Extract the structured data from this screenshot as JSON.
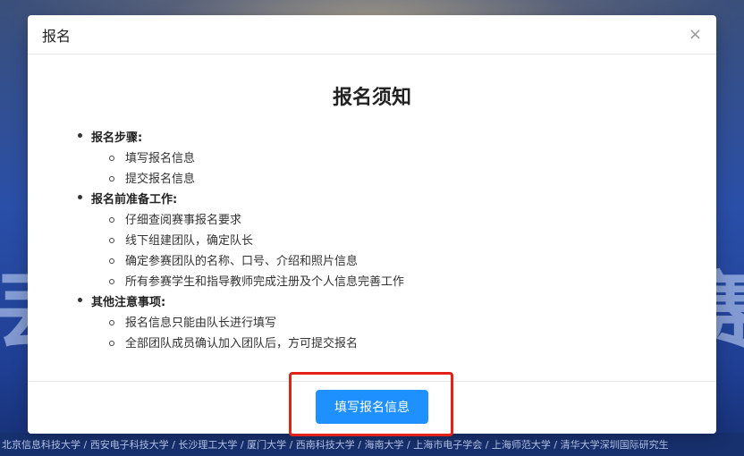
{
  "background": {
    "big_left_text": "丟",
    "big_right_text": "赛",
    "universities": "北京信息科技大学 / 西安电子科技大学 / 长沙理工大学 / 厦门大学 / 西南科技大学 / 海南大学 / 上海市电子学会 / 上海师范大学 / 清华大学深圳国际研究生"
  },
  "modal": {
    "title": "报名",
    "close_icon": "×",
    "notice_title": "报名须知",
    "sections": [
      {
        "label": "报名步骤:",
        "items": [
          "填写报名信息",
          "提交报名信息"
        ]
      },
      {
        "label": "报名前准备工作:",
        "items": [
          "仔细查阅赛事报名要求",
          "线下组建团队，确定队长",
          "确定参赛团队的名称、口号、介绍和照片信息",
          "所有参赛学生和指导教师完成注册及个人信息完善工作"
        ]
      },
      {
        "label": "其他注意事项:",
        "items": [
          "报名信息只能由队长进行填写",
          "全部团队成员确认加入团队后，方可提交报名"
        ]
      }
    ],
    "primary_button": "填写报名信息"
  },
  "colors": {
    "primary": "#1e90ff",
    "highlight": "#e32119"
  },
  "icons": {
    "close": "close-icon"
  }
}
